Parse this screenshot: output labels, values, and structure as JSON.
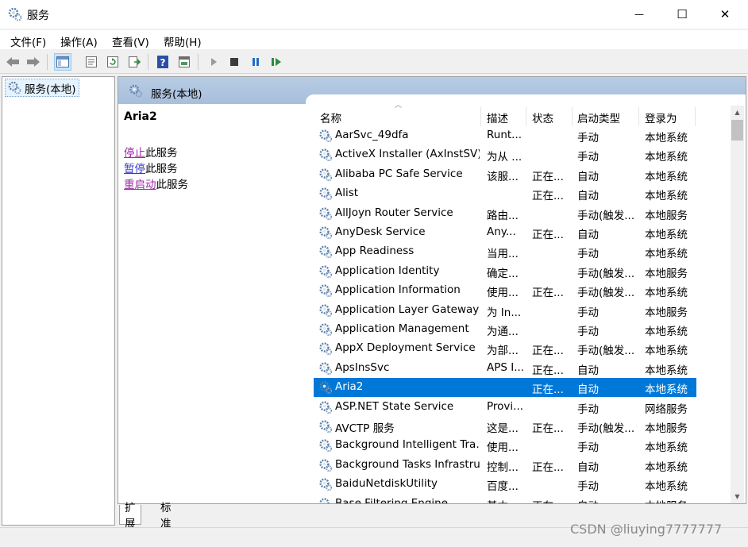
{
  "window": {
    "title": "服务",
    "controls": {
      "minimize": "—",
      "maximize": "☐",
      "close": "✕"
    }
  },
  "menu": [
    "文件(F)",
    "操作(A)",
    "查看(V)",
    "帮助(H)"
  ],
  "toolbar": [
    "back-icon",
    "forward-icon",
    "show-hide-tree-icon",
    "properties-icon",
    "refresh-icon",
    "export-list-icon",
    "help-icon",
    "console-icon",
    "start-service-icon",
    "stop-service-icon",
    "pause-service-icon",
    "restart-service-icon"
  ],
  "tree": {
    "item": "服务(本地)"
  },
  "pane": {
    "title": "服务(本地)",
    "selected_service": "Aria2",
    "actions": [
      {
        "link": "停止",
        "suffix": "此服务"
      },
      {
        "link": "暂停",
        "suffix": "此服务"
      },
      {
        "link": "重启动",
        "suffix": "此服务"
      }
    ]
  },
  "columns": {
    "name": "名称",
    "desc": "描述",
    "state": "状态",
    "start": "启动类型",
    "logon": "登录为"
  },
  "services": [
    {
      "name": "AarSvc_49dfa",
      "desc": "Runt...",
      "state": "",
      "start": "手动",
      "logon": "本地系统"
    },
    {
      "name": "ActiveX Installer (AxInstSV)",
      "desc": "为从 ...",
      "state": "",
      "start": "手动",
      "logon": "本地系统"
    },
    {
      "name": "Alibaba PC Safe Service",
      "desc": "该服...",
      "state": "正在...",
      "start": "自动",
      "logon": "本地系统"
    },
    {
      "name": "Alist",
      "desc": "",
      "state": "正在...",
      "start": "自动",
      "logon": "本地系统"
    },
    {
      "name": "AllJoyn Router Service",
      "desc": "路由...",
      "state": "",
      "start": "手动(触发...",
      "logon": "本地服务"
    },
    {
      "name": "AnyDesk Service",
      "desc": "Any...",
      "state": "正在...",
      "start": "自动",
      "logon": "本地系统"
    },
    {
      "name": "App Readiness",
      "desc": "当用...",
      "state": "",
      "start": "手动",
      "logon": "本地系统"
    },
    {
      "name": "Application Identity",
      "desc": "确定...",
      "state": "",
      "start": "手动(触发...",
      "logon": "本地服务"
    },
    {
      "name": "Application Information",
      "desc": "使用...",
      "state": "正在...",
      "start": "手动(触发...",
      "logon": "本地系统"
    },
    {
      "name": "Application Layer Gateway ...",
      "desc": "为 In...",
      "state": "",
      "start": "手动",
      "logon": "本地服务"
    },
    {
      "name": "Application Management",
      "desc": "为通...",
      "state": "",
      "start": "手动",
      "logon": "本地系统"
    },
    {
      "name": "AppX Deployment Service ...",
      "desc": "为部...",
      "state": "正在...",
      "start": "手动(触发...",
      "logon": "本地系统"
    },
    {
      "name": "ApsInsSvc",
      "desc": "APS I...",
      "state": "正在...",
      "start": "自动",
      "logon": "本地系统"
    },
    {
      "name": "Aria2",
      "desc": "",
      "state": "正在...",
      "start": "自动",
      "logon": "本地系统",
      "selected": true
    },
    {
      "name": "ASP.NET State Service",
      "desc": "Provi...",
      "state": "",
      "start": "手动",
      "logon": "网络服务"
    },
    {
      "name": "AVCTP 服务",
      "desc": "这是...",
      "state": "正在...",
      "start": "手动(触发...",
      "logon": "本地服务"
    },
    {
      "name": "Background Intelligent Tra...",
      "desc": "使用...",
      "state": "",
      "start": "手动",
      "logon": "本地系统"
    },
    {
      "name": "Background Tasks Infrastru...",
      "desc": "控制...",
      "state": "正在...",
      "start": "自动",
      "logon": "本地系统"
    },
    {
      "name": "BaiduNetdiskUtility",
      "desc": "百度...",
      "state": "",
      "start": "手动",
      "logon": "本地系统"
    },
    {
      "name": "Base Filtering Engine",
      "desc": "基本...",
      "state": "正在...",
      "start": "自动",
      "logon": "本地服务"
    }
  ],
  "tabs": [
    "扩展",
    "标准"
  ],
  "watermark": "CSDN @liuying7777777",
  "colors": {
    "selection": "#0078d7",
    "header": "#b8cce4",
    "link": "#3a3acd",
    "visited_link": "#9b2aa5"
  }
}
